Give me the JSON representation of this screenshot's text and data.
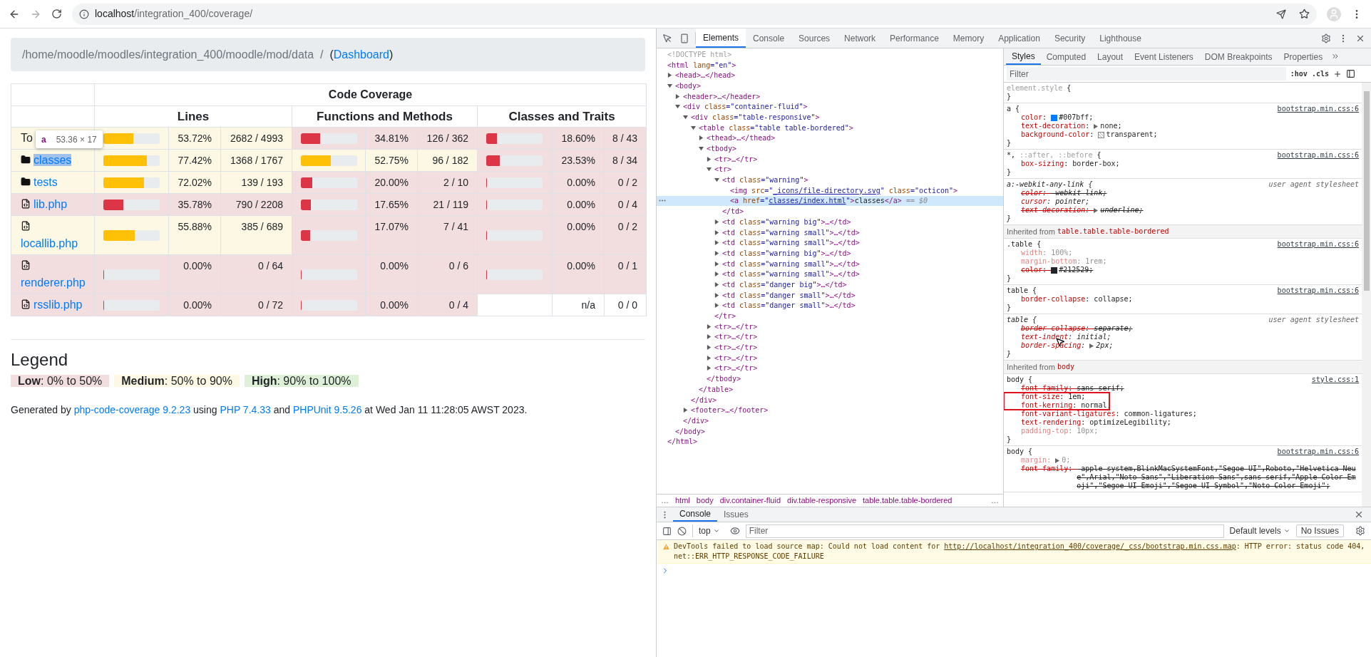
{
  "browser": {
    "forward_disabled": true,
    "url_host": "localhost",
    "url_path": "/integration_400/coverage/"
  },
  "page": {
    "breadcrumb": [
      {
        "t": "/home/moodle/moodles/integration_400/moodle/mod/data  /  ",
        "kind": "muted"
      },
      {
        "t": "(",
        "kind": "text"
      },
      {
        "t": "Dashboard",
        "kind": "link"
      },
      {
        "t": ")",
        "kind": "text"
      }
    ],
    "table": {
      "title": "Code Coverage",
      "groups": [
        "Lines",
        "Functions and Methods",
        "Classes and Traits"
      ],
      "rows": [
        {
          "name": "To",
          "kind": "plain",
          "link": false,
          "highlighted": false,
          "lines": {
            "kind": "warning",
            "level": 0.5372,
            "pct": "53.72%",
            "count": "2682 / 4993"
          },
          "functions": {
            "kind": "danger",
            "level": 0.3481,
            "pct": "34.81%",
            "count": "126 / 362"
          },
          "classes": {
            "kind": "danger",
            "level": 0.186,
            "pct": "18.60%",
            "count": "8 / 43"
          }
        },
        {
          "name": "classes",
          "kind": "folder",
          "link": true,
          "highlighted": true,
          "lines": {
            "kind": "warning",
            "level": 0.7742,
            "pct": "77.42%",
            "count": "1368 / 1767"
          },
          "functions": {
            "kind": "warning",
            "level": 0.5275,
            "pct": "52.75%",
            "count": "96 / 182"
          },
          "classes": {
            "kind": "danger",
            "level": 0.2353,
            "pct": "23.53%",
            "count": "8 / 34"
          }
        },
        {
          "name": "tests",
          "kind": "folder",
          "link": true,
          "highlighted": false,
          "lines": {
            "kind": "warning",
            "level": 0.7202,
            "pct": "72.02%",
            "count": "139 / 193"
          },
          "functions": {
            "kind": "danger",
            "level": 0.2,
            "pct": "20.00%",
            "count": "2 / 10"
          },
          "classes": {
            "kind": "danger",
            "level": 0,
            "pct": "0.00%",
            "count": "0 / 2"
          }
        },
        {
          "name": "lib.php",
          "kind": "file",
          "link": true,
          "highlighted": false,
          "lines": {
            "kind": "danger",
            "level": 0.3578,
            "pct": "35.78%",
            "count": "790 / 2208"
          },
          "functions": {
            "kind": "danger",
            "level": 0.1765,
            "pct": "17.65%",
            "count": "21 / 119"
          },
          "classes": {
            "kind": "danger",
            "level": 0,
            "pct": "0.00%",
            "count": "0 / 4"
          }
        },
        {
          "name": "locallib.php",
          "kind": "file",
          "link": true,
          "highlighted": false,
          "lines": {
            "kind": "warning",
            "level": 0.5588,
            "pct": "55.88%",
            "count": "385 / 689"
          },
          "functions": {
            "kind": "danger",
            "level": 0.1707,
            "pct": "17.07%",
            "count": "7 / 41"
          },
          "classes": {
            "kind": "danger",
            "level": 0,
            "pct": "0.00%",
            "count": "0 / 2"
          }
        },
        {
          "name": "renderer.php",
          "kind": "file",
          "link": true,
          "highlighted": false,
          "lines": {
            "kind": "danger",
            "level": 0,
            "pct": "0.00%",
            "count": "0 / 64"
          },
          "functions": {
            "kind": "danger",
            "level": 0,
            "pct": "0.00%",
            "count": "0 / 6"
          },
          "classes": {
            "kind": "danger",
            "level": 0,
            "pct": "0.00%",
            "count": "0 / 1"
          }
        },
        {
          "name": "rsslib.php",
          "kind": "file",
          "link": true,
          "highlighted": false,
          "lines": {
            "kind": "danger",
            "level": 0,
            "pct": "0.00%",
            "count": "0 / 72"
          },
          "functions": {
            "kind": "danger",
            "level": 0,
            "pct": "0.00%",
            "count": "0 / 4"
          },
          "classes": {
            "kind": "none",
            "pct": "n/a",
            "count": "0 / 0"
          }
        }
      ],
      "tooltip": {
        "tag": "a",
        "size": "53.36 × 17"
      }
    },
    "legend": {
      "title": "Legend",
      "items": [
        {
          "label": "Low",
          "text": ": 0% to 50%",
          "color": "#f2dede"
        },
        {
          "label": "Medium",
          "text": ": 50% to 90%",
          "color": "#fcf8e3"
        },
        {
          "label": "High",
          "text": ": 90% to 100%",
          "color": "#dff0d8"
        }
      ]
    },
    "footer": [
      {
        "t": "Generated by ",
        "kind": "text"
      },
      {
        "t": "php-code-coverage 9.2.23",
        "kind": "link"
      },
      {
        "t": " using ",
        "kind": "text"
      },
      {
        "t": "PHP 7.4.33",
        "kind": "link"
      },
      {
        "t": " and ",
        "kind": "text"
      },
      {
        "t": "PHPUnit 9.5.26",
        "kind": "link"
      },
      {
        "t": " at Wed Jan 11 11:28:05 AWST 2023.",
        "kind": "text"
      }
    ]
  },
  "devtools": {
    "tabs": [
      {
        "label": "Elements",
        "selected": true
      },
      {
        "label": "Console",
        "selected": false
      },
      {
        "label": "Sources",
        "selected": false
      },
      {
        "label": "Network",
        "selected": false
      },
      {
        "label": "Performance",
        "selected": false
      },
      {
        "label": "Memory",
        "selected": false
      },
      {
        "label": "Application",
        "selected": false
      },
      {
        "label": "Security",
        "selected": false
      },
      {
        "label": "Lighthouse",
        "selected": false
      }
    ],
    "dom": [
      {
        "parts": [
          {
            "t": "<!DOCTYPE html>",
            "kind": "dim"
          }
        ],
        "selected": false
      },
      {
        "parts": [
          {
            "t": "<html ",
            "kind": "tag"
          },
          {
            "t": "lang",
            "kind": "attr"
          },
          {
            "t": "=\"en\"",
            "kind": "val"
          },
          {
            "t": ">",
            "kind": "tag"
          }
        ],
        "selected": false,
        "close": [
          {
            "t": "</html>",
            "kind": "tag"
          }
        ],
        "children": [
          {
            "parts": [
              {
                "t": "<head>…</head>",
                "kind": "tag"
              }
            ],
            "expanded": false,
            "selected": false
          },
          {
            "parts": [
              {
                "t": "<body>",
                "kind": "tag"
              }
            ],
            "expanded": true,
            "selected": false,
            "close": [
              {
                "t": "</body>",
                "kind": "tag"
              }
            ],
            "children": [
              {
                "parts": [
                  {
                    "t": "<header>…</header>",
                    "kind": "tag"
                  }
                ],
                "expanded": false,
                "selected": false
              },
              {
                "parts": [
                  {
                    "t": "<div ",
                    "kind": "tag"
                  },
                  {
                    "t": "class",
                    "kind": "attr"
                  },
                  {
                    "t": "=\"container-fluid\"",
                    "kind": "val"
                  },
                  {
                    "t": ">",
                    "kind": "tag"
                  }
                ],
                "expanded": true,
                "selected": false,
                "close": [
                  {
                    "t": "</div>",
                    "kind": "tag"
                  }
                ],
                "children": [
                  {
                    "parts": [
                      {
                        "t": "<div ",
                        "kind": "tag"
                      },
                      {
                        "t": "class",
                        "kind": "attr"
                      },
                      {
                        "t": "=\"table-responsive\"",
                        "kind": "val"
                      },
                      {
                        "t": ">",
                        "kind": "tag"
                      }
                    ],
                    "expanded": true,
                    "selected": false,
                    "close": [
                      {
                        "t": "</div>",
                        "kind": "tag"
                      }
                    ],
                    "children": [
                      {
                        "parts": [
                          {
                            "t": "<table ",
                            "kind": "tag"
                          },
                          {
                            "t": "class",
                            "kind": "attr"
                          },
                          {
                            "t": "=\"table table-bordered\"",
                            "kind": "val"
                          },
                          {
                            "t": ">",
                            "kind": "tag"
                          }
                        ],
                        "expanded": true,
                        "selected": false,
                        "close": [
                          {
                            "t": "</table>",
                            "kind": "tag"
                          }
                        ],
                        "children": [
                          {
                            "parts": [
                              {
                                "t": "<thead>…</thead>",
                                "kind": "tag"
                              }
                            ],
                            "expanded": false,
                            "selected": false
                          },
                          {
                            "parts": [
                              {
                                "t": "<tbody>",
                                "kind": "tag"
                              }
                            ],
                            "expanded": true,
                            "selected": false,
                            "close": [
                              {
                                "t": "</tbody>",
                                "kind": "tag"
                              }
                            ],
                            "children": [
                              {
                                "parts": [
                                  {
                                    "t": "<tr>…</tr>",
                                    "kind": "tag"
                                  }
                                ],
                                "expanded": false,
                                "selected": false
                              },
                              {
                                "parts": [
                                  {
                                    "t": "<tr>",
                                    "kind": "tag"
                                  }
                                ],
                                "expanded": true,
                                "selected": false,
                                "close": [
                                  {
                                    "t": "</tr>",
                                    "kind": "tag"
                                  }
                                ],
                                "children": [
                                  {
                                    "parts": [
                                      {
                                        "t": "<td ",
                                        "kind": "tag"
                                      },
                                      {
                                        "t": "class",
                                        "kind": "attr"
                                      },
                                      {
                                        "t": "=\"warning\"",
                                        "kind": "val"
                                      },
                                      {
                                        "t": ">",
                                        "kind": "tag"
                                      }
                                    ],
                                    "expanded": true,
                                    "selected": false,
                                    "close": [
                                      {
                                        "t": "</td>",
                                        "kind": "tag"
                                      }
                                    ],
                                    "children": [
                                      {
                                        "parts": [
                                          {
                                            "t": "<img ",
                                            "kind": "tag"
                                          },
                                          {
                                            "t": "src",
                                            "kind": "attr"
                                          },
                                          {
                                            "t": "=\"",
                                            "kind": "val"
                                          },
                                          {
                                            "t": "_icons/file-directory.svg",
                                            "kind": "link"
                                          },
                                          {
                                            "t": "\" ",
                                            "kind": "val"
                                          },
                                          {
                                            "t": "class",
                                            "kind": "attr"
                                          },
                                          {
                                            "t": "=\"octicon\"",
                                            "kind": "val"
                                          },
                                          {
                                            "t": ">",
                                            "kind": "tag"
                                          }
                                        ],
                                        "selected": false
                                      },
                                      {
                                        "parts": [
                                          {
                                            "t": "<a ",
                                            "kind": "tag"
                                          },
                                          {
                                            "t": "href",
                                            "kind": "attr"
                                          },
                                          {
                                            "t": "=\"",
                                            "kind": "val"
                                          },
                                          {
                                            "t": "classes/index.html",
                                            "kind": "link"
                                          },
                                          {
                                            "t": "\"",
                                            "kind": "val"
                                          },
                                          {
                                            "t": ">",
                                            "kind": "tag"
                                          },
                                          {
                                            "t": "classes",
                                            "kind": "text"
                                          },
                                          {
                                            "t": "</a>",
                                            "kind": "tag"
                                          },
                                          {
                                            "t": " == $0",
                                            "kind": "ghost"
                                          }
                                        ],
                                        "selected": true
                                      }
                                    ]
                                  },
                                  {
                                    "parts": [
                                      {
                                        "t": "<td ",
                                        "kind": "tag"
                                      },
                                      {
                                        "t": "class",
                                        "kind": "attr"
                                      },
                                      {
                                        "t": "=\"warning big\"",
                                        "kind": "val"
                                      },
                                      {
                                        "t": ">…</td>",
                                        "kind": "tag"
                                      }
                                    ],
                                    "expanded": false,
                                    "selected": false
                                  },
                                  {
                                    "parts": [
                                      {
                                        "t": "<td ",
                                        "kind": "tag"
                                      },
                                      {
                                        "t": "class",
                                        "kind": "attr"
                                      },
                                      {
                                        "t": "=\"warning small\"",
                                        "kind": "val"
                                      },
                                      {
                                        "t": ">…</td>",
                                        "kind": "tag"
                                      }
                                    ],
                                    "expanded": false,
                                    "selected": false
                                  },
                                  {
                                    "parts": [
                                      {
                                        "t": "<td ",
                                        "kind": "tag"
                                      },
                                      {
                                        "t": "class",
                                        "kind": "attr"
                                      },
                                      {
                                        "t": "=\"warning small\"",
                                        "kind": "val"
                                      },
                                      {
                                        "t": ">…</td>",
                                        "kind": "tag"
                                      }
                                    ],
                                    "expanded": false,
                                    "selected": false
                                  },
                                  {
                                    "parts": [
                                      {
                                        "t": "<td ",
                                        "kind": "tag"
                                      },
                                      {
                                        "t": "class",
                                        "kind": "attr"
                                      },
                                      {
                                        "t": "=\"warning big\"",
                                        "kind": "val"
                                      },
                                      {
                                        "t": ">…</td>",
                                        "kind": "tag"
                                      }
                                    ],
                                    "expanded": false,
                                    "selected": false
                                  },
                                  {
                                    "parts": [
                                      {
                                        "t": "<td ",
                                        "kind": "tag"
                                      },
                                      {
                                        "t": "class",
                                        "kind": "attr"
                                      },
                                      {
                                        "t": "=\"warning small\"",
                                        "kind": "val"
                                      },
                                      {
                                        "t": ">…</td>",
                                        "kind": "tag"
                                      }
                                    ],
                                    "expanded": false,
                                    "selected": false
                                  },
                                  {
                                    "parts": [
                                      {
                                        "t": "<td ",
                                        "kind": "tag"
                                      },
                                      {
                                        "t": "class",
                                        "kind": "attr"
                                      },
                                      {
                                        "t": "=\"warning small\"",
                                        "kind": "val"
                                      },
                                      {
                                        "t": ">…</td>",
                                        "kind": "tag"
                                      }
                                    ],
                                    "expanded": false,
                                    "selected": false
                                  },
                                  {
                                    "parts": [
                                      {
                                        "t": "<td ",
                                        "kind": "tag"
                                      },
                                      {
                                        "t": "class",
                                        "kind": "attr"
                                      },
                                      {
                                        "t": "=\"danger big\"",
                                        "kind": "val"
                                      },
                                      {
                                        "t": ">…</td>",
                                        "kind": "tag"
                                      }
                                    ],
                                    "expanded": false,
                                    "selected": false
                                  },
                                  {
                                    "parts": [
                                      {
                                        "t": "<td ",
                                        "kind": "tag"
                                      },
                                      {
                                        "t": "class",
                                        "kind": "attr"
                                      },
                                      {
                                        "t": "=\"danger small\"",
                                        "kind": "val"
                                      },
                                      {
                                        "t": ">…</td>",
                                        "kind": "tag"
                                      }
                                    ],
                                    "expanded": false,
                                    "selected": false
                                  },
                                  {
                                    "parts": [
                                      {
                                        "t": "<td ",
                                        "kind": "tag"
                                      },
                                      {
                                        "t": "class",
                                        "kind": "attr"
                                      },
                                      {
                                        "t": "=\"danger small\"",
                                        "kind": "val"
                                      },
                                      {
                                        "t": ">…</td>",
                                        "kind": "tag"
                                      }
                                    ],
                                    "expanded": false,
                                    "selected": false
                                  }
                                ]
                              },
                              {
                                "parts": [
                                  {
                                    "t": "<tr>…</tr>",
                                    "kind": "tag"
                                  }
                                ],
                                "expanded": false,
                                "selected": false
                              },
                              {
                                "parts": [
                                  {
                                    "t": "<tr>…</tr>",
                                    "kind": "tag"
                                  }
                                ],
                                "expanded": false,
                                "selected": false
                              },
                              {
                                "parts": [
                                  {
                                    "t": "<tr>…</tr>",
                                    "kind": "tag"
                                  }
                                ],
                                "expanded": false,
                                "selected": false
                              },
                              {
                                "parts": [
                                  {
                                    "t": "<tr>…</tr>",
                                    "kind": "tag"
                                  }
                                ],
                                "expanded": false,
                                "selected": false
                              },
                              {
                                "parts": [
                                  {
                                    "t": "<tr>…</tr>",
                                    "kind": "tag"
                                  }
                                ],
                                "expanded": false,
                                "selected": false
                              }
                            ]
                          }
                        ]
                      }
                    ]
                  },
                  {
                    "parts": [
                      {
                        "t": "<footer>…</footer>",
                        "kind": "tag"
                      }
                    ],
                    "expanded": false,
                    "selected": false
                  }
                ]
              }
            ]
          }
        ]
      }
    ],
    "crumbs_lead": "…",
    "crumbs": [
      "html",
      "body",
      "div.container-fluid",
      "div.table-responsive",
      "table.table.table-bordered"
    ],
    "crumbs_more": "…",
    "styles": {
      "tabs": [
        {
          "label": "Styles",
          "selected": true
        },
        {
          "label": "Computed",
          "selected": false
        },
        {
          "label": "Layout",
          "selected": false
        },
        {
          "label": "Event Listeners",
          "selected": false
        },
        {
          "label": "DOM Breakpoints",
          "selected": false
        },
        {
          "label": "Properties",
          "selected": false
        }
      ],
      "filter_placeholder": "Filter",
      "hov": ":hov",
      "cls": ".cls",
      "rules": [
        {
          "kind": "rule",
          "selector": [
            {
              "t": "element.style",
              "kind": "dim"
            },
            {
              "t": " {",
              "kind": "sel"
            }
          ],
          "ua": false,
          "close": "}"
        },
        {
          "kind": "rule",
          "selector": [
            {
              "t": "a {",
              "kind": "sel"
            }
          ],
          "source": "bootstrap.min.css:6",
          "ua": false,
          "close": "}",
          "props": [
            {
              "name": "color",
              "colon": ": ",
              "kind": "color",
              "color": "#007bff",
              "value": "#007bff;",
              "struck": false,
              "faded": false
            },
            {
              "name": "text-decoration",
              "colon": ": ",
              "expandable": true,
              "value": "none;",
              "struck": false,
              "faded": false
            },
            {
              "name": "background-color",
              "colon": ": ",
              "kind": "checker",
              "value": "transparent;",
              "struck": false,
              "faded": false
            }
          ]
        },
        {
          "kind": "rule",
          "selector": [
            {
              "t": "*, ",
              "kind": "sel"
            },
            {
              "t": "::after, ::before",
              "kind": "dim"
            },
            {
              "t": " {",
              "kind": "sel"
            }
          ],
          "source": "bootstrap.min.css:6",
          "ua": false,
          "close": "}",
          "props": [
            {
              "name": "box-sizing",
              "colon": ": ",
              "value": "border-box;",
              "struck": false,
              "faded": false
            }
          ]
        },
        {
          "kind": "rule",
          "selector": [
            {
              "t": "a:-webkit-any-link {",
              "kind": "sel"
            }
          ],
          "source": "user agent stylesheet",
          "ua": true,
          "close": "}",
          "props": [
            {
              "name": "color",
              "colon": ": ",
              "value": "-webkit-link;",
              "struck": true,
              "faded": false
            },
            {
              "name": "cursor",
              "colon": ": ",
              "value": "pointer;",
              "struck": false,
              "faded": false
            },
            {
              "name": "text-decoration",
              "colon": ": ",
              "expandable": true,
              "value": "underline;",
              "struck": true,
              "faded": false
            }
          ]
        },
        {
          "kind": "inherited",
          "label": "Inherited from ",
          "target": "table.table.table-bordered"
        },
        {
          "kind": "rule",
          "selector": [
            {
              "t": ".table {",
              "kind": "sel"
            }
          ],
          "source": "bootstrap.min.css:6",
          "ua": false,
          "close": "}",
          "props": [
            {
              "name": "width",
              "colon": ": ",
              "value": "100%;",
              "struck": false,
              "faded": true
            },
            {
              "name": "margin-bottom",
              "colon": ": ",
              "value": "1rem;",
              "struck": false,
              "faded": true
            },
            {
              "name": "color",
              "colon": ": ",
              "kind": "color",
              "color": "#212529",
              "value": "#212529;",
              "struck": true,
              "faded": false
            }
          ]
        },
        {
          "kind": "rule",
          "selector": [
            {
              "t": "table {",
              "kind": "sel"
            }
          ],
          "source": "bootstrap.min.css:6",
          "ua": false,
          "close": "}",
          "props": [
            {
              "name": "border-collapse",
              "colon": ": ",
              "value": "collapse;",
              "struck": false,
              "faded": false
            }
          ]
        },
        {
          "kind": "rule",
          "selector": [
            {
              "t": "table {",
              "kind": "sel"
            }
          ],
          "source": "user agent stylesheet",
          "ua": true,
          "close": "}",
          "props": [
            {
              "name": "border-collapse",
              "colon": ": ",
              "value": "separate;",
              "struck": true,
              "faded": false
            },
            {
              "name": "text-indent",
              "colon": ": ",
              "value": "initial;",
              "struck": false,
              "faded": false,
              "pointer": true
            },
            {
              "name": "border-spacing",
              "colon": ": ",
              "expandable": true,
              "value": "2px;",
              "struck": false,
              "faded": false
            }
          ]
        },
        {
          "kind": "inherited",
          "label": "Inherited from ",
          "target": "body"
        },
        {
          "kind": "rule",
          "selector": [
            {
              "t": "body {",
              "kind": "sel"
            }
          ],
          "source": "style.css:1",
          "ua": false,
          "close": "}",
          "props": [
            {
              "name": "font-family",
              "colon": ": ",
              "value": "sans-serif;",
              "struck": true,
              "faded": false
            },
            {
              "name": "font-size",
              "colon": ": ",
              "value": "1em;",
              "struck": false,
              "faded": false,
              "boxed": true
            },
            {
              "name": "font-kerning",
              "colon": ": ",
              "value": "normal;",
              "struck": false,
              "faded": false,
              "boxed": true
            },
            {
              "name": "font-variant-ligatures",
              "colon": ": ",
              "value": "common-ligatures;",
              "struck": false,
              "faded": false
            },
            {
              "name": "text-rendering",
              "colon": ": ",
              "value": "optimizeLegibility;",
              "struck": false,
              "faded": false
            },
            {
              "name": "padding-top",
              "colon": ": ",
              "value": "10px;",
              "struck": false,
              "faded": true
            }
          ]
        },
        {
          "kind": "rule",
          "selector": [
            {
              "t": "body {",
              "kind": "sel"
            }
          ],
          "source": "bootstrap.min.css:6",
          "ua": false,
          "props": [
            {
              "name": "margin",
              "colon": ": ",
              "expandable": true,
              "value": "0;",
              "struck": false,
              "faded": true
            },
            {
              "name": "font-family",
              "colon": ": ",
              "value": "-apple-system,BlinkMacSystemFont,\"Segoe UI\",Roboto,\"Helvetica Neue\",Arial,\"Noto Sans\",\"Liberation Sans\",sans-serif,\"Apple Color Emoji\",\"Segoe UI Emoji\",\"Segoe UI Symbol\",\"Noto Color Emoji\";",
              "struck": true,
              "faded": false
            }
          ]
        }
      ]
    },
    "console": {
      "tabs": [
        {
          "label": "Console",
          "selected": true
        },
        {
          "label": "Issues",
          "selected": false
        }
      ],
      "context": "top",
      "filter_placeholder": "Filter",
      "levels": "Default levels",
      "issues": "No Issues",
      "messages": [
        {
          "kind": "warning",
          "parts": [
            {
              "t": "DevTools failed to load source map: Could not load content for ",
              "kind": "text"
            },
            {
              "t": "http://localhost/integration_400/coverage/_css/bootstrap.min.css.map",
              "kind": "link"
            },
            {
              "t": ": HTTP error: status code 404, net::ERR_HTTP_RESPONSE_CODE_FAILURE",
              "kind": "text"
            }
          ]
        }
      ]
    }
  }
}
